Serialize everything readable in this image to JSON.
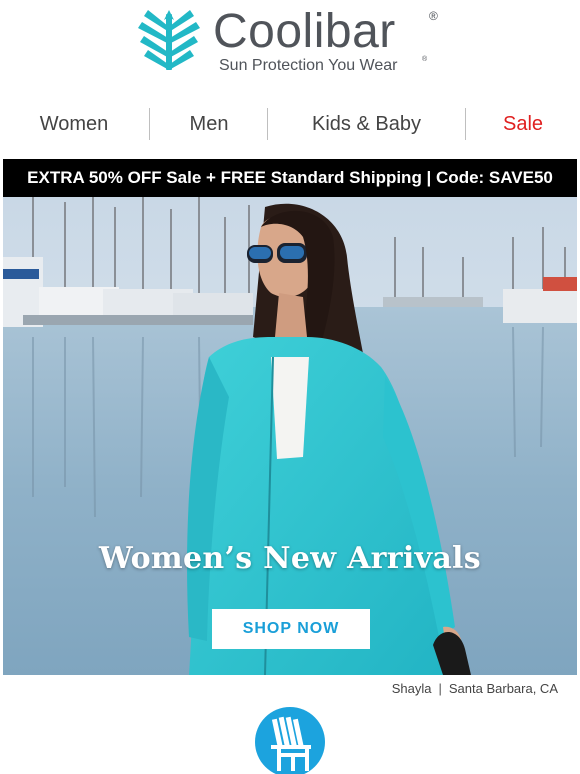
{
  "brand": {
    "name": "Coolibar",
    "registered_mark": "®",
    "tagline": "Sun Protection You Wear",
    "tagline_mark": "®",
    "logo_icon": "tree-icon",
    "accent": "#22b8c6"
  },
  "nav": {
    "items": [
      {
        "label": "Women"
      },
      {
        "label": "Men"
      },
      {
        "label": "Kids & Baby"
      },
      {
        "label": "Sale",
        "color": "#e02020"
      }
    ]
  },
  "promo": {
    "text": "EXTRA 50% OFF Sale + FREE Standard Shipping | Code: SAVE50"
  },
  "hero": {
    "title": "Women’s New Arrivals",
    "cta_label": "SHOP NOW",
    "cta_color": "#1a9fd8",
    "image_subject": "woman in turquoise zip hoodie at marina"
  },
  "caption": {
    "model": "Shayla",
    "separator": "|",
    "location": "Santa Barbara, CA"
  },
  "footer": {
    "icon": "adirondack-chair-icon",
    "badge_color": "#1ca3de"
  }
}
